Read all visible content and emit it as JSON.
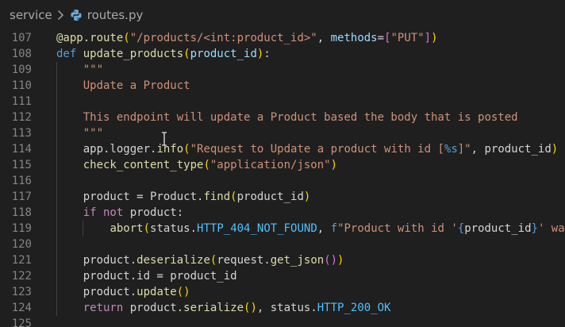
{
  "breadcrumb": {
    "folder": "service",
    "file": "routes.py"
  },
  "editor": {
    "lines": [
      {
        "n": "107",
        "tokens": [
          {
            "t": "@app.route",
            "c": "dec"
          },
          {
            "t": "(",
            "c": "br1"
          },
          {
            "t": "\"/products/<int:product_id>\"",
            "c": "str"
          },
          {
            "t": ", ",
            "c": "plain"
          },
          {
            "t": "methods",
            "c": "var"
          },
          {
            "t": "=",
            "c": "plain"
          },
          {
            "t": "[",
            "c": "br2"
          },
          {
            "t": "\"PUT\"",
            "c": "str"
          },
          {
            "t": "]",
            "c": "br2"
          },
          {
            "t": ")",
            "c": "br1"
          }
        ]
      },
      {
        "n": "108",
        "tokens": [
          {
            "t": "def ",
            "c": "kw"
          },
          {
            "t": "update_products",
            "c": "fn"
          },
          {
            "t": "(",
            "c": "br1"
          },
          {
            "t": "product_id",
            "c": "var"
          },
          {
            "t": ")",
            "c": "br1"
          },
          {
            "t": ":",
            "c": "plain"
          }
        ]
      },
      {
        "n": "109",
        "indent": 1,
        "tokens": [
          {
            "t": "    \"\"\"",
            "c": "doc"
          }
        ]
      },
      {
        "n": "110",
        "indent": 1,
        "tokens": [
          {
            "t": "    Update a Product",
            "c": "doc"
          }
        ]
      },
      {
        "n": "111",
        "indent": 1,
        "tokens": []
      },
      {
        "n": "112",
        "indent": 1,
        "tokens": [
          {
            "t": "    This endpoint will update a Product based the body that is posted",
            "c": "doc"
          }
        ]
      },
      {
        "n": "113",
        "indent": 1,
        "tokens": [
          {
            "t": "    \"\"\"",
            "c": "doc"
          }
        ]
      },
      {
        "n": "114",
        "indent": 1,
        "tokens": [
          {
            "t": "    app.logger.",
            "c": "plain"
          },
          {
            "t": "info",
            "c": "fn"
          },
          {
            "t": "(",
            "c": "br1"
          },
          {
            "t": "\"Request to Update a product with id [",
            "c": "str"
          },
          {
            "t": "%s",
            "c": "esc"
          },
          {
            "t": "]\"",
            "c": "str"
          },
          {
            "t": ", product_id",
            "c": "plain"
          },
          {
            "t": ")",
            "c": "br1"
          }
        ]
      },
      {
        "n": "115",
        "indent": 1,
        "tokens": [
          {
            "t": "    ",
            "c": "plain"
          },
          {
            "t": "check_content_type",
            "c": "fn"
          },
          {
            "t": "(",
            "c": "br1"
          },
          {
            "t": "\"application/json\"",
            "c": "str"
          },
          {
            "t": ")",
            "c": "br1"
          }
        ]
      },
      {
        "n": "116",
        "indent": 1,
        "tokens": []
      },
      {
        "n": "117",
        "indent": 1,
        "tokens": [
          {
            "t": "    product = Product.",
            "c": "plain"
          },
          {
            "t": "find",
            "c": "fn"
          },
          {
            "t": "(",
            "c": "br1"
          },
          {
            "t": "product_id",
            "c": "plain"
          },
          {
            "t": ")",
            "c": "br1"
          }
        ]
      },
      {
        "n": "118",
        "indent": 1,
        "tokens": [
          {
            "t": "    ",
            "c": "plain"
          },
          {
            "t": "if not ",
            "c": "ctl"
          },
          {
            "t": "product:",
            "c": "plain"
          }
        ]
      },
      {
        "n": "119",
        "indent": 2,
        "tokens": [
          {
            "t": "        ",
            "c": "plain"
          },
          {
            "t": "abort",
            "c": "fn"
          },
          {
            "t": "(",
            "c": "br1"
          },
          {
            "t": "status.",
            "c": "plain"
          },
          {
            "t": "HTTP_404_NOT_FOUND",
            "c": "const"
          },
          {
            "t": ", ",
            "c": "plain"
          },
          {
            "t": "f",
            "c": "kw"
          },
          {
            "t": "\"Product with id '",
            "c": "str"
          },
          {
            "t": "{",
            "c": "esc"
          },
          {
            "t": "product_id",
            "c": "plain"
          },
          {
            "t": "}",
            "c": "esc"
          },
          {
            "t": "' was",
            "c": "str"
          }
        ]
      },
      {
        "n": "120",
        "indent": 1,
        "tokens": []
      },
      {
        "n": "121",
        "indent": 1,
        "tokens": [
          {
            "t": "    product.",
            "c": "plain"
          },
          {
            "t": "deserialize",
            "c": "fn"
          },
          {
            "t": "(",
            "c": "br1"
          },
          {
            "t": "request.",
            "c": "plain"
          },
          {
            "t": "get_json",
            "c": "fn"
          },
          {
            "t": "()",
            "c": "br2"
          },
          {
            "t": ")",
            "c": "br1"
          }
        ]
      },
      {
        "n": "122",
        "indent": 1,
        "tokens": [
          {
            "t": "    product.id = product_id",
            "c": "plain"
          }
        ]
      },
      {
        "n": "123",
        "indent": 1,
        "tokens": [
          {
            "t": "    product.",
            "c": "plain"
          },
          {
            "t": "update",
            "c": "fn"
          },
          {
            "t": "()",
            "c": "br1"
          }
        ]
      },
      {
        "n": "124",
        "indent": 1,
        "tokens": [
          {
            "t": "    ",
            "c": "plain"
          },
          {
            "t": "return ",
            "c": "ctl"
          },
          {
            "t": "product.",
            "c": "plain"
          },
          {
            "t": "serialize",
            "c": "fn"
          },
          {
            "t": "()",
            "c": "br1"
          },
          {
            "t": ", status.",
            "c": "plain"
          },
          {
            "t": "HTTP_200_OK",
            "c": "const"
          }
        ]
      },
      {
        "n": "125",
        "tokens": []
      }
    ]
  },
  "icons": {
    "chevron": "chevron-right-icon",
    "file": "python-file-icon"
  }
}
